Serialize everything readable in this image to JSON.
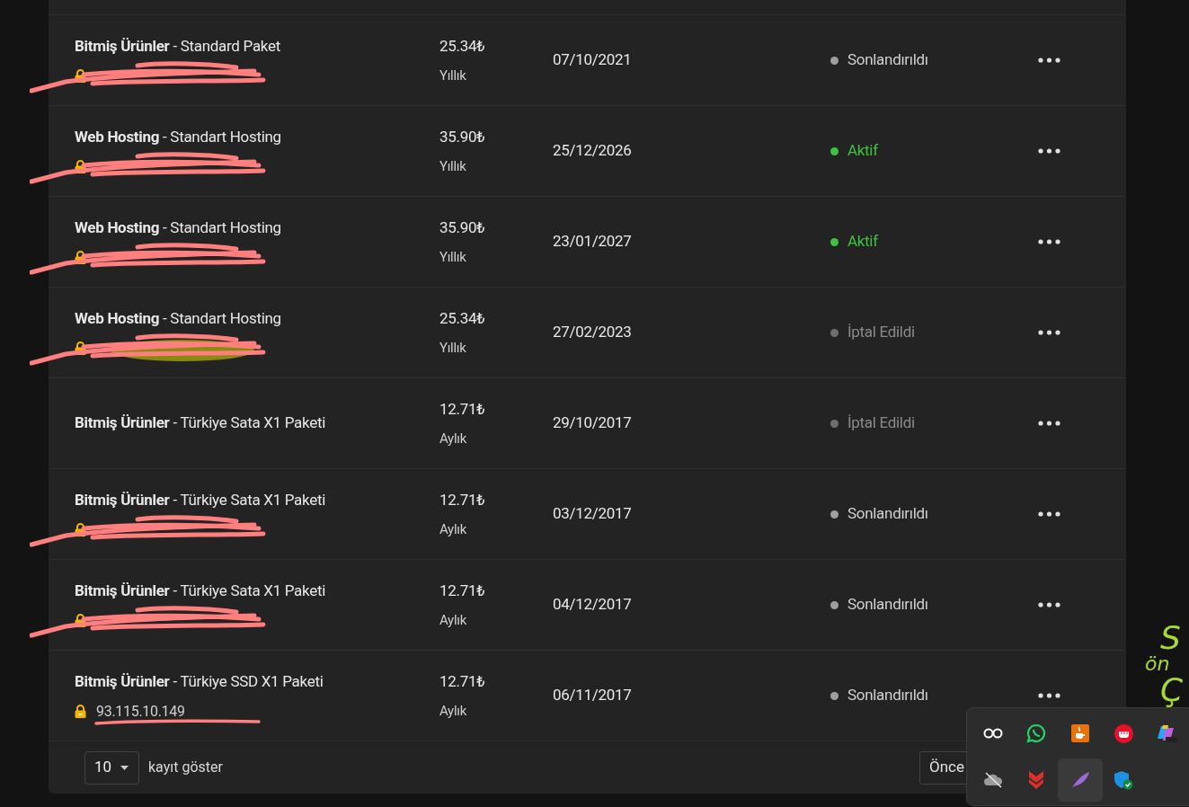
{
  "rows": [
    {
      "title": "**Bitmiş Ürünler** - Standard Paket",
      "domain": {
        "redacted": true,
        "tint": false
      },
      "price": "25.34₺",
      "cycle": "Yıllık",
      "date": "07/10/2021",
      "status": {
        "kind": "ended",
        "label": "Sonlandırıldı",
        "color": "#9e9e9e"
      }
    },
    {
      "title": "**Web Hosting** - Standart Hosting",
      "domain": {
        "redacted": true,
        "tint": false
      },
      "price": "35.90₺",
      "cycle": "Yıllık",
      "date": "25/12/2026",
      "status": {
        "kind": "active",
        "label": "Aktif",
        "color": "#3ec13e"
      }
    },
    {
      "title": "**Web Hosting** - Standart Hosting",
      "domain": {
        "redacted": true,
        "tint": false
      },
      "price": "35.90₺",
      "cycle": "Yıllık",
      "date": "23/01/2027",
      "status": {
        "kind": "active",
        "label": "Aktif",
        "color": "#3ec13e"
      }
    },
    {
      "title": "**Web Hosting** - Standart Hosting",
      "domain": {
        "redacted": true,
        "tint": true
      },
      "price": "25.34₺",
      "cycle": "Yıllık",
      "date": "27/02/2023",
      "status": {
        "kind": "cancelled",
        "label": "İptal Edildi",
        "color": "#6e6e6e"
      }
    },
    {
      "title": "**Bitmiş Ürünler** - Türkiye Sata X1 Paketi",
      "price": "12.71₺",
      "cycle": "Aylık",
      "date": "29/10/2017",
      "status": {
        "kind": "cancelled",
        "label": "İptal Edildi",
        "color": "#6e6e6e"
      }
    },
    {
      "title": "**Bitmiş Ürünler** - Türkiye Sata X1 Paketi",
      "domain": {
        "redacted": true,
        "tint": false
      },
      "price": "12.71₺",
      "cycle": "Aylık",
      "date": "03/12/2017",
      "status": {
        "kind": "ended",
        "label": "Sonlandırıldı",
        "color": "#9e9e9e"
      }
    },
    {
      "title": "**Bitmiş Ürünler** - Türkiye Sata X1 Paketi",
      "domain": {
        "redacted": true,
        "tint": false
      },
      "price": "12.71₺",
      "cycle": "Aylık",
      "date": "04/12/2017",
      "status": {
        "kind": "ended",
        "label": "Sonlandırıldı",
        "color": "#9e9e9e"
      }
    },
    {
      "title": "**Bitmiş Ürünler** - Türkiye SSD X1 Paketi",
      "domain": {
        "text": "93.115.10.149",
        "redacted": false
      },
      "price": "12.71₺",
      "cycle": "Aylık",
      "date": "06/11/2017",
      "status": {
        "kind": "ended",
        "label": "Sonlandırıldı",
        "color": "#9e9e9e"
      }
    }
  ],
  "footer": {
    "page_size": "10",
    "page_size_label": "kayıt göster",
    "prev_button": "Önce"
  },
  "wallpaper_text": [
    "S",
    "ön",
    "Ç"
  ],
  "tray": {
    "items": [
      {
        "kind": "link",
        "highlighted": false
      },
      {
        "kind": "chat",
        "highlighted": false
      },
      {
        "kind": "cup",
        "highlighted": false
      },
      {
        "kind": "fist",
        "highlighted": false
      },
      {
        "kind": "app",
        "highlighted": false
      },
      {
        "kind": "cloud-off",
        "highlighted": false
      },
      {
        "kind": "chevron",
        "highlighted": false
      },
      {
        "kind": "feather",
        "highlighted": true
      },
      {
        "kind": "shield",
        "highlighted": false
      }
    ]
  }
}
